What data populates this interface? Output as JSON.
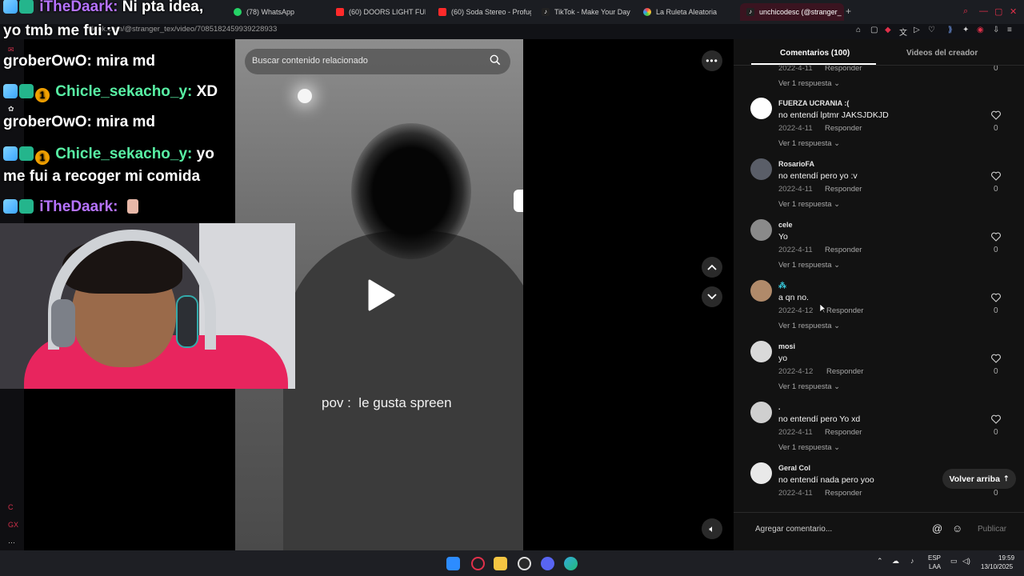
{
  "browser": {
    "tabs": [
      {
        "label": "(78) WhatsApp",
        "icon": "whatsapp-icon"
      },
      {
        "label": "(60) DOORS LIGHT FUNK",
        "icon": "youtube-icon"
      },
      {
        "label": "(60) Soda Stereo - Profug",
        "icon": "youtube-icon"
      },
      {
        "label": "TikTok - Make Your Day",
        "icon": "tiktok-icon"
      },
      {
        "label": "La Ruleta Aleatoria",
        "icon": "roulette-icon"
      },
      {
        "label": "unchicodesc (@stranger_",
        "icon": "tiktok-icon"
      }
    ],
    "url": "tiktok.com/@stranger_tex/video/7085182459939228933"
  },
  "chat": {
    "messages": [
      {
        "user": "iTheDaark:",
        "text": "Ni pta idea,",
        "color": "#b673ff"
      },
      {
        "user": "",
        "text": "yo tmb me fui :v"
      },
      {
        "user": "groberOwO:",
        "text": "mira md"
      },
      {
        "user": "Chicle_sekacho_y:",
        "text": "XD",
        "color": "#58f0a4"
      },
      {
        "user": "groberOwO:",
        "text": "mira md"
      },
      {
        "user": "Chicle_sekacho_y:",
        "text": "yo",
        "color": "#58f0a4"
      },
      {
        "user": "",
        "text": "me fui a recoger mi comida"
      },
      {
        "user": "iTheDaark:",
        "text": "",
        "color": "#b673ff"
      }
    ]
  },
  "video": {
    "search_placeholder": "Buscar contenido relacionado",
    "caption": "pov :  le gusta spreen"
  },
  "comments_panel": {
    "tab_comments": "Comentarios (100)",
    "tab_videos": "Videos del creador",
    "reply_label": "Responder",
    "top_partial": {
      "date": "2022-4-11",
      "more": "Ver 1 respuesta",
      "likes": "0"
    },
    "comments": [
      {
        "user": "FUERZA UCRANIA :(",
        "text": "no entendí lptmr JAKSJDKJD",
        "date": "2022-4-11",
        "more": "Ver 1 respuesta",
        "likes": "0",
        "avatar_color": "#ffffff"
      },
      {
        "user": "RosarioFA",
        "text": "no entendí pero yo :v",
        "date": "2022-4-11",
        "more": "Ver 1 respuesta",
        "likes": "0",
        "avatar_color": "#6b6f78"
      },
      {
        "user": "cele",
        "text": "Yo",
        "date": "2022-4-11",
        "more": "Ver 1 respuesta",
        "likes": "0",
        "avatar_color": "#9a9a9a"
      },
      {
        "user": "",
        "text": "a qn no.",
        "date": "2022-4-12",
        "more": "Ver 1 respuesta",
        "likes": "0",
        "avatar_color": "#b08a6a"
      },
      {
        "user": "mosi",
        "text": "yo",
        "date": "2022-4-12",
        "more": "Ver 1 respuesta",
        "likes": "0",
        "avatar_color": "#d9d9d9"
      },
      {
        "user": ".",
        "text": "no entendí pero Yo xd",
        "date": "2022-4-11",
        "more": "Ver 1 respuesta",
        "likes": "0",
        "avatar_color": "#cfcfcf"
      },
      {
        "user": "Geral Col",
        "text": "no entendí nada pero yoo",
        "date": "2022-4-11",
        "more": "",
        "likes": "0",
        "avatar_color": "#e9e9e9"
      }
    ],
    "back_to_top": "Volver arriba",
    "add_comment_placeholder": "Agregar comentario...",
    "publish": "Publicar"
  },
  "taskbar": {
    "lang": "ESP",
    "lang2": "LAA",
    "time": "19:59",
    "date": "13/10/2025"
  },
  "colors": {
    "accent": "#e0304a",
    "panel_bg": "#121212"
  }
}
